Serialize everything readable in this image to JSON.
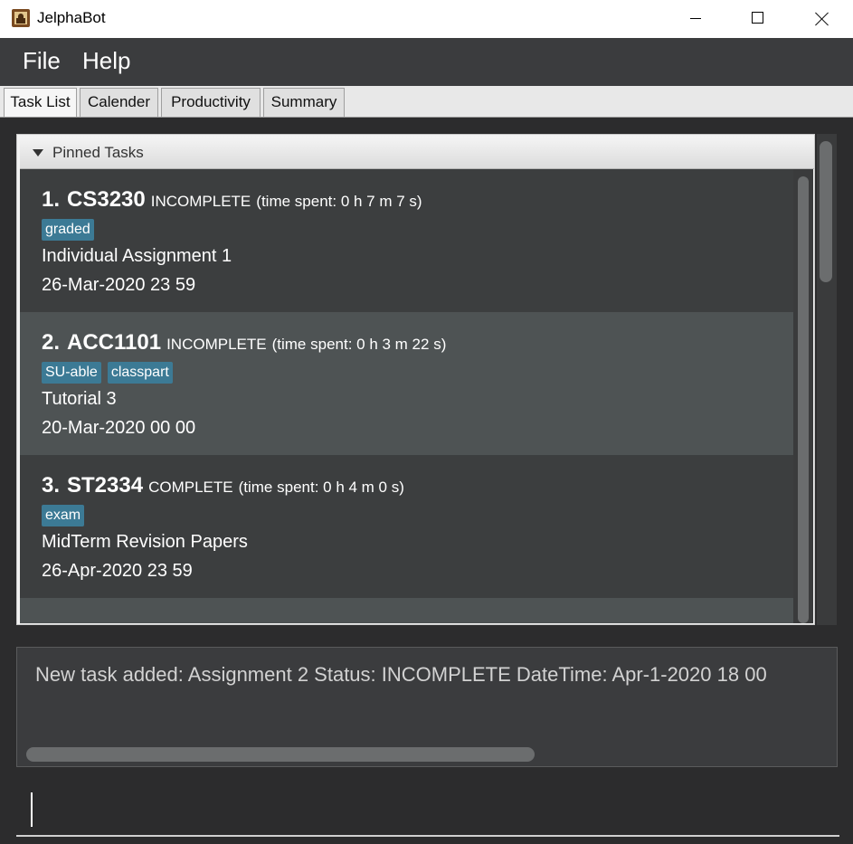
{
  "window": {
    "title": "JelphaBot"
  },
  "menu": {
    "file": "File",
    "help": "Help"
  },
  "tabs": [
    {
      "label": "Task List",
      "active": true
    },
    {
      "label": "Calender",
      "active": false
    },
    {
      "label": "Productivity",
      "active": false
    },
    {
      "label": "Summary",
      "active": false
    }
  ],
  "pinned": {
    "label": "Pinned Tasks"
  },
  "tasks": [
    {
      "index": "1.",
      "code": "CS3230",
      "status": "INCOMPLETE",
      "time": "(time spent: 0 h 7 m 7 s)",
      "tags": [
        "graded"
      ],
      "description": "Individual Assignment 1",
      "date": "26-Mar-2020 23 59"
    },
    {
      "index": "2.",
      "code": "ACC1101",
      "status": "INCOMPLETE",
      "time": "(time spent: 0 h 3 m 22 s)",
      "tags": [
        "SU-able",
        "classpart"
      ],
      "description": "Tutorial 3",
      "date": "20-Mar-2020 00 00"
    },
    {
      "index": "3.",
      "code": "ST2334",
      "status": "COMPLETE",
      "time": "(time spent: 0 h 4 m 0 s)",
      "tags": [
        "exam"
      ],
      "description": "MidTerm Revision Papers",
      "date": "26-Apr-2020 23 59"
    }
  ],
  "result": {
    "text": "New task added: Assignment 2 Status: INCOMPLETE DateTime: Apr-1-2020 18 00"
  },
  "command": {
    "value": ""
  },
  "colors": {
    "tag": "#3c7a95",
    "row_odd": "#3c3e3f",
    "row_even": "#4e5354",
    "background": "#2c2c2d"
  }
}
